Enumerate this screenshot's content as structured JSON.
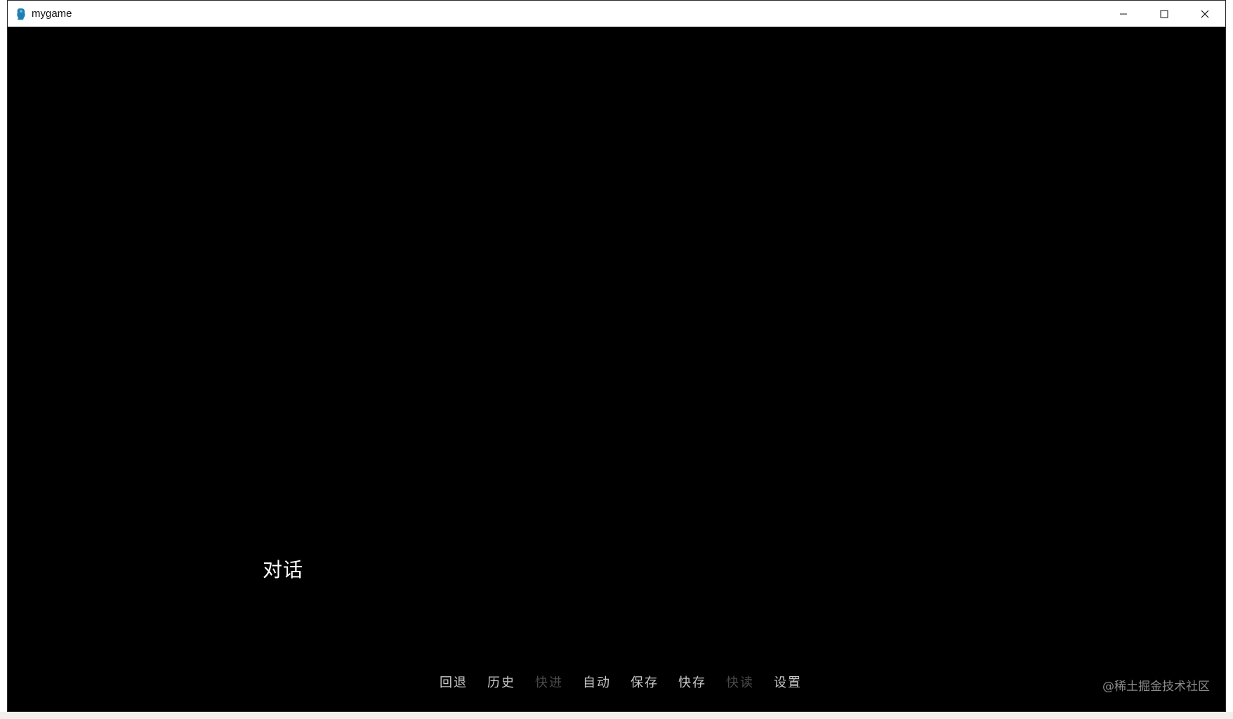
{
  "window": {
    "title": "mygame",
    "controls": {
      "minimize": "minimize-icon",
      "maximize": "maximize-icon",
      "close": "close-icon"
    }
  },
  "game": {
    "dialogue": "对话",
    "quick_menu": [
      {
        "label": "回退",
        "enabled": true
      },
      {
        "label": "历史",
        "enabled": true
      },
      {
        "label": "快进",
        "enabled": false
      },
      {
        "label": "自动",
        "enabled": true
      },
      {
        "label": "保存",
        "enabled": true
      },
      {
        "label": "快存",
        "enabled": true
      },
      {
        "label": "快读",
        "enabled": false
      },
      {
        "label": "设置",
        "enabled": true
      }
    ]
  },
  "watermark": "@稀土掘金技术社区",
  "colors": {
    "background": "#000000",
    "text": "#ffffff",
    "menu_enabled": "#c8c8c8",
    "menu_disabled": "#4a4a4a",
    "icon_accent": "#1e7fb0"
  }
}
